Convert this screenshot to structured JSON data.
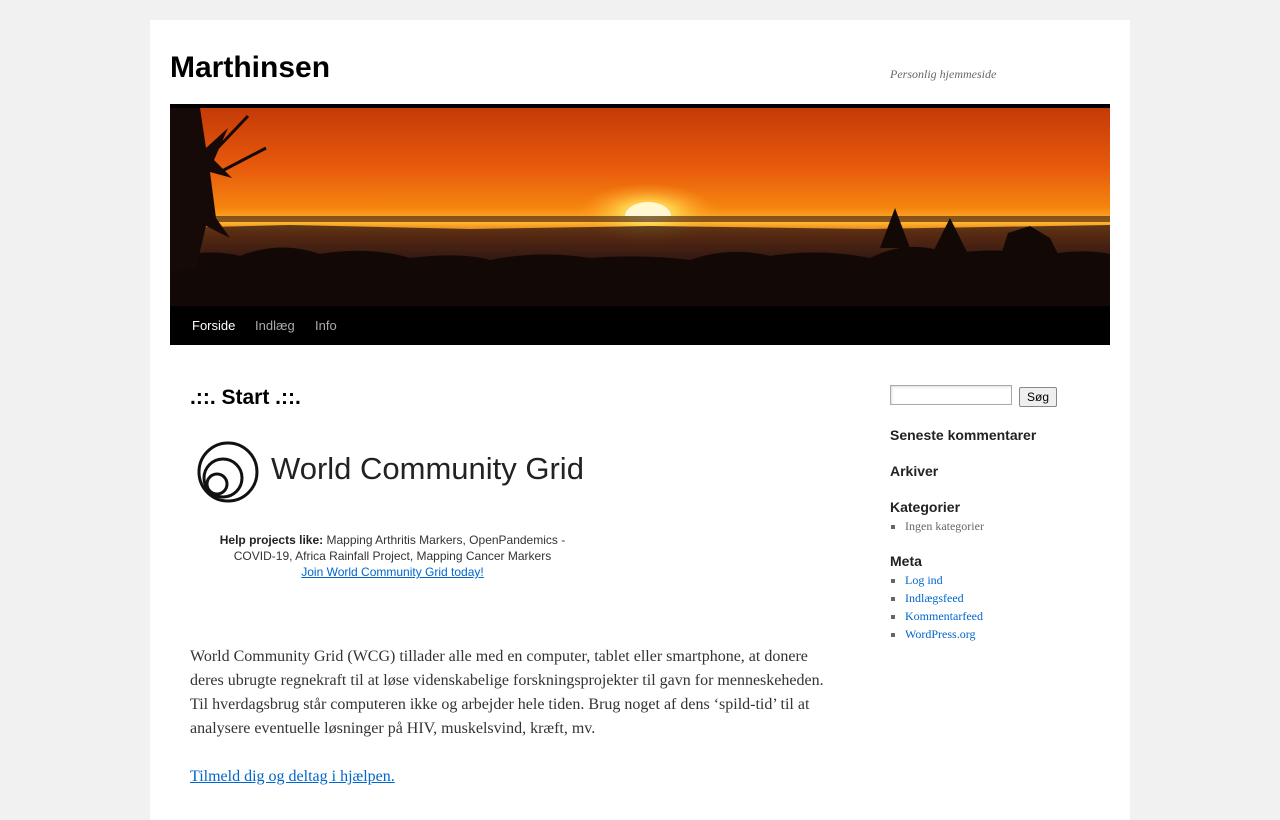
{
  "site": {
    "title": "Marthinsen",
    "description": "Personlig hjemmeside"
  },
  "nav": {
    "items": [
      {
        "label": "Forside"
      },
      {
        "label": "Indlæg"
      },
      {
        "label": "Info"
      }
    ]
  },
  "post": {
    "title": ".::. Start .::.",
    "logo_text": "World Community Grid",
    "help_label": "Help projects like:",
    "help_text": "Mapping Arthritis Markers, OpenPandemics - COVID-19, Africa Rainfall Project, Mapping Cancer Markers",
    "join_link": "Join World Community Grid today!",
    "paragraph": "World Community Grid (WCG) tillader alle med en computer, tablet eller smartphone, at donere deres ubrugte regnekraft til at løse videnskabelige forskningsprojekter til gavn for menneskeheden. Til hverdagsbrug står computeren ikke og arbejder hele tiden. Brug noget af dens ‘spild-tid’ til at analysere eventuelle løsninger på HIV, muskelsvind, kræft, mv.",
    "signup_link": "Tilmeld dig og deltag i hjælpen."
  },
  "sidebar": {
    "search_value": "",
    "search_button": "Søg",
    "recent_comments_title": "Seneste kommentarer",
    "archives_title": "Arkiver",
    "categories_title": "Kategorier",
    "categories": [
      "Ingen kategorier"
    ],
    "meta_title": "Meta",
    "meta_links": [
      "Log ind",
      "Indlægsfeed",
      "Kommentarfeed",
      "WordPress.org"
    ]
  },
  "colors": {
    "link": "#0066cc",
    "nav_bg": "#000000",
    "page_bg": "#f1f1f1"
  }
}
